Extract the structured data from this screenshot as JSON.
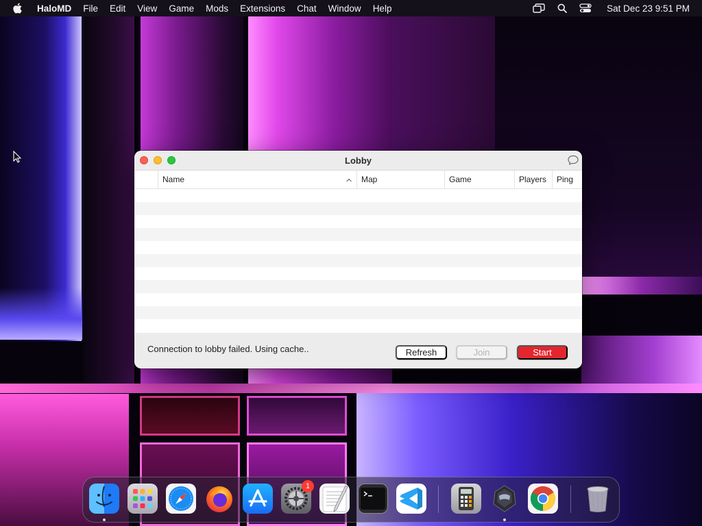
{
  "menubar": {
    "app_name": "HaloMD",
    "items": [
      "File",
      "Edit",
      "View",
      "Game",
      "Mods",
      "Extensions",
      "Chat",
      "Window",
      "Help"
    ],
    "clock": "Sat Dec 23  9:51 PM"
  },
  "window": {
    "title": "Lobby",
    "columns": [
      "Name",
      "Map",
      "Game",
      "Players",
      "Ping"
    ],
    "status_message": "Connection to lobby failed. Using cache..",
    "buttons": {
      "refresh": "Refresh",
      "join": "Join",
      "start": "Start"
    }
  },
  "dock": {
    "items": [
      {
        "id": "finder",
        "icon": "finder-icon",
        "running": true
      },
      {
        "id": "launchpad",
        "icon": "launchpad-icon",
        "running": false
      },
      {
        "id": "safari",
        "icon": "safari-icon",
        "running": false
      },
      {
        "id": "firefox",
        "icon": "firefox-icon",
        "running": false
      },
      {
        "id": "app-store",
        "icon": "app-store-icon",
        "running": false
      },
      {
        "id": "system-settings",
        "icon": "system-settings-icon",
        "running": false,
        "badge": "1"
      },
      {
        "id": "textedit",
        "icon": "textedit-icon",
        "running": false
      },
      {
        "id": "terminal",
        "icon": "terminal-icon",
        "running": false
      },
      {
        "id": "vscode",
        "icon": "vscode-icon",
        "running": false
      },
      {
        "id": "calculator",
        "icon": "calculator-icon",
        "running": false
      },
      {
        "id": "halomd",
        "icon": "halomd-icon",
        "running": true
      },
      {
        "id": "chrome",
        "icon": "chrome-icon",
        "running": false
      },
      {
        "id": "trash",
        "icon": "trash-icon",
        "running": false
      }
    ]
  },
  "colors": {
    "start_button": "#e3262e",
    "close_light": "#fe5f57",
    "minimize_light": "#febc2e",
    "zoom_light": "#28c840"
  }
}
